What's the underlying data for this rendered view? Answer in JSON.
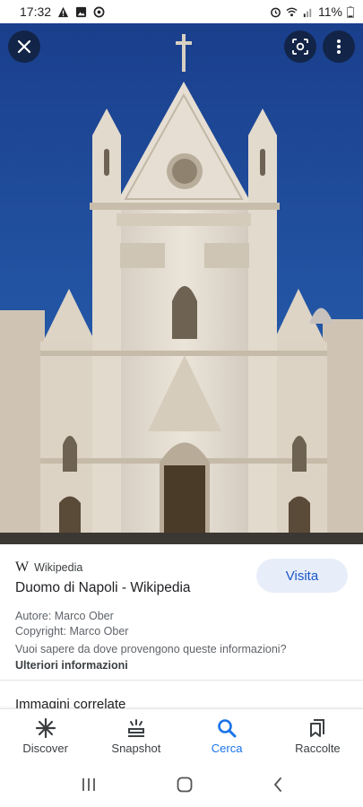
{
  "status_bar": {
    "time": "17:32",
    "battery": "11%",
    "icons": [
      "warning-icon",
      "image-icon",
      "sync-icon",
      "alarm-icon",
      "wifi-icon",
      "signal-icon",
      "battery-icon"
    ]
  },
  "viewer": {
    "close_icon": "close-icon",
    "lens_icon": "lens-icon",
    "more_icon": "more-vert-icon"
  },
  "result": {
    "source": "Wikipedia",
    "title": "Duomo di Napoli - Wikipedia",
    "visit_label": "Visita",
    "author": "Autore: Marco Ober",
    "copyright": "Copyright: Marco Ober",
    "question": "Vuoi sapere da dove provengono queste informazioni?",
    "more_info": "Ulteriori informazioni",
    "related": "Immagini correlate"
  },
  "bottom_nav": {
    "items": [
      {
        "label": "Discover",
        "icon": "discover-icon"
      },
      {
        "label": "Snapshot",
        "icon": "snapshot-icon"
      },
      {
        "label": "Cerca",
        "icon": "search-icon"
      },
      {
        "label": "Raccolte",
        "icon": "collections-icon"
      }
    ],
    "active": "Cerca"
  },
  "colors": {
    "sky": "#1c4f9e",
    "accent": "#1a73e8",
    "visit_bg": "#e8eef9"
  }
}
